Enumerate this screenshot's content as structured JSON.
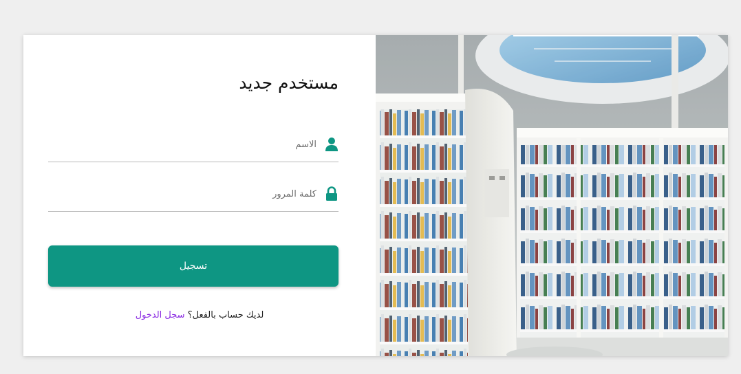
{
  "form": {
    "title": "مستخدم جديد",
    "name_placeholder": "الاسم",
    "password_placeholder": "كلمة المرور",
    "submit_label": "تسجيل",
    "login_prompt": "لديك حساب بالفعل؟",
    "login_link": "سجل الدخول"
  },
  "icons": {
    "name_field_icon": "user-icon",
    "password_field_icon": "lock-icon"
  },
  "colors": {
    "accent": "#0e9683",
    "link": "#8a2be2",
    "page_background": "#efefef"
  }
}
